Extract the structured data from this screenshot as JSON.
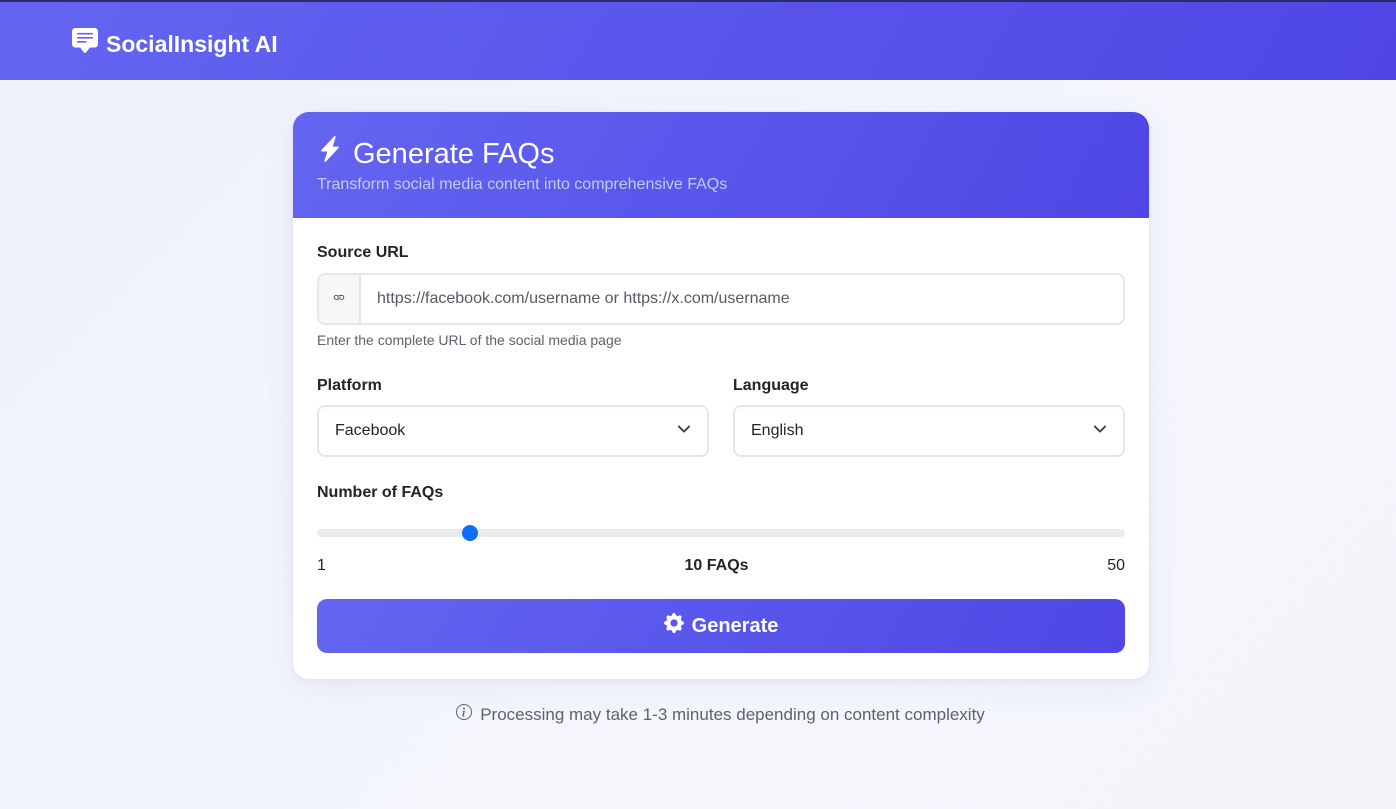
{
  "app": {
    "brand_name": "SocialInsight AI",
    "brand_icon": "chat-square-text-icon"
  },
  "card": {
    "title": "Generate FAQs",
    "title_icon": "lightning-icon",
    "subtitle": "Transform social media content into comprehensive FAQs"
  },
  "form": {
    "source_url": {
      "label": "Source URL",
      "placeholder": "https://facebook.com/username or https://x.com/username",
      "value": "",
      "icon": "link-icon",
      "help": "Enter the complete URL of the social media page"
    },
    "platform": {
      "label": "Platform",
      "selected": "Facebook"
    },
    "language": {
      "label": "Language",
      "selected": "English"
    },
    "faq_count": {
      "label": "Number of FAQs",
      "min": "1",
      "max": "50",
      "value": 10,
      "value_label": "10 FAQs"
    },
    "generate_button": {
      "label": "Generate",
      "icon": "gear-icon"
    }
  },
  "footer": {
    "note": "Processing may take 1-3 minutes depending on content complexity",
    "icon": "info-circle-icon"
  },
  "colors": {
    "primary": "#6366f1",
    "primary_dark": "#4f46e5",
    "slider_thumb": "#0d6efd"
  }
}
